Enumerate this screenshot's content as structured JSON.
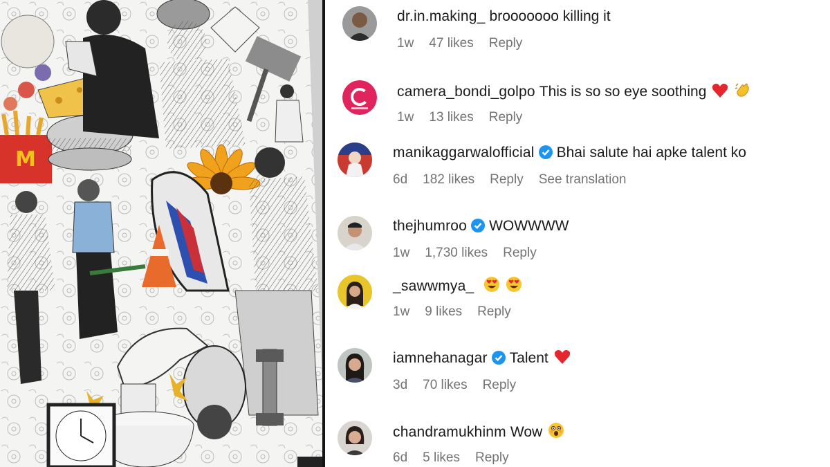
{
  "comments": [
    {
      "username": "dr.in.making_",
      "verified": false,
      "text": "brooooooo killing it",
      "time": "1w",
      "likes": "47 likes",
      "reply": "Reply",
      "emoji": []
    },
    {
      "username": "camera_bondi_golpo",
      "verified": false,
      "text": "This is so so eye soothing",
      "time": "1w",
      "likes": "13 likes",
      "reply": "Reply",
      "emoji": [
        "red-heart",
        "clapping-hands"
      ]
    },
    {
      "username": "manikaggarwalofficial",
      "verified": true,
      "text": "Bhai salute hai apke talent ko",
      "time": "6d",
      "likes": "182 likes",
      "reply": "Reply",
      "translation": "See translation",
      "emoji": []
    },
    {
      "username": "thejhumroo",
      "verified": true,
      "text": "WOWWWW",
      "time": "1w",
      "likes": "1,730 likes",
      "reply": "Reply",
      "emoji": []
    },
    {
      "username": "_sawwmya_",
      "verified": false,
      "text": "",
      "time": "1w",
      "likes": "9 likes",
      "reply": "Reply",
      "emoji": [
        "heart-eyes",
        "heart-eyes"
      ]
    },
    {
      "username": "iamnehanagar",
      "verified": true,
      "text": "Talent",
      "time": "3d",
      "likes": "70 likes",
      "reply": "Reply",
      "emoji": [
        "red-heart"
      ]
    },
    {
      "username": "chandramukhinm",
      "verified": false,
      "text": "Wow",
      "time": "6d",
      "likes": "5 likes",
      "reply": "Reply",
      "emoji": [
        "astonished-face"
      ]
    }
  ],
  "colors": {
    "verified_badge": "#1d95f0",
    "meta_text": "#737373",
    "brand_avatar_pink": "#e0245e"
  }
}
